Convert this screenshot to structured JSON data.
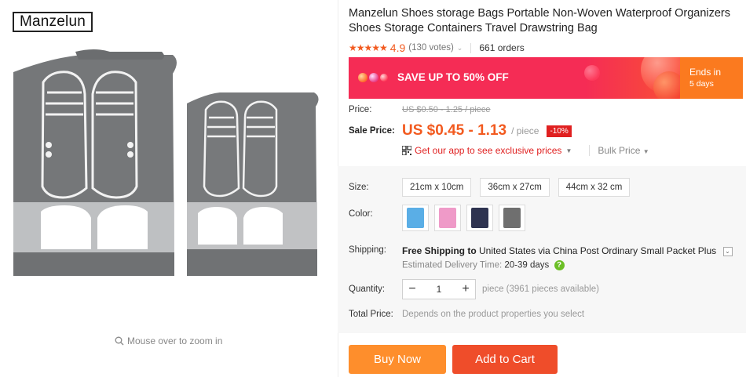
{
  "brand": {
    "name": "Manzelun"
  },
  "gallery": {
    "zoom_hint": "Mouse over to zoom in"
  },
  "product": {
    "title": "Manzelun Shoes storage Bags Portable Non-Woven Waterproof Organizers Shoes Storage Containers Travel Drawstring Bag",
    "stars": "★★★★★",
    "rating": "4.9",
    "votes": "(130 votes)",
    "orders": "661 orders"
  },
  "banner": {
    "text": "SAVE UP TO 50% OFF",
    "ends_label": "Ends in",
    "ends_days": "5 days"
  },
  "price": {
    "price_label": "Price:",
    "original": "US $0.50 - 1.25 / piece",
    "sale_label": "Sale Price:",
    "sale": "US $0.45 - 1.13",
    "per": "/ piece",
    "discount": "-10%",
    "app_link": "Get our app to see exclusive prices",
    "bulk": "Bulk Price"
  },
  "options": {
    "size_label": "Size:",
    "sizes": [
      "21cm x 10cm",
      "36cm x 27cm",
      "44cm x 32 cm"
    ],
    "color_label": "Color:",
    "colors": [
      "#5aaee6",
      "#ef9ac8",
      "#2e3350",
      "#6f6f6f"
    ],
    "shipping_label": "Shipping:",
    "shipping_free": "Free Shipping to",
    "shipping_dest": "United States via China Post Ordinary Small Packet Plus",
    "eta_label": "Estimated Delivery Time:",
    "eta_value": "20-39 days",
    "quantity_label": "Quantity:",
    "quantity_minus": "−",
    "quantity_value": "1",
    "quantity_plus": "+",
    "quantity_note": "piece (3961 pieces available)",
    "total_label": "Total Price:",
    "total_note": "Depends on the product properties you select"
  },
  "actions": {
    "buy_now": "Buy Now",
    "add_to_cart": "Add to Cart"
  },
  "accent_colors": {
    "orange": "#f25a1f",
    "red": "#e02020",
    "buy": "#fe8e2c",
    "cart": "#ef4d2a"
  }
}
